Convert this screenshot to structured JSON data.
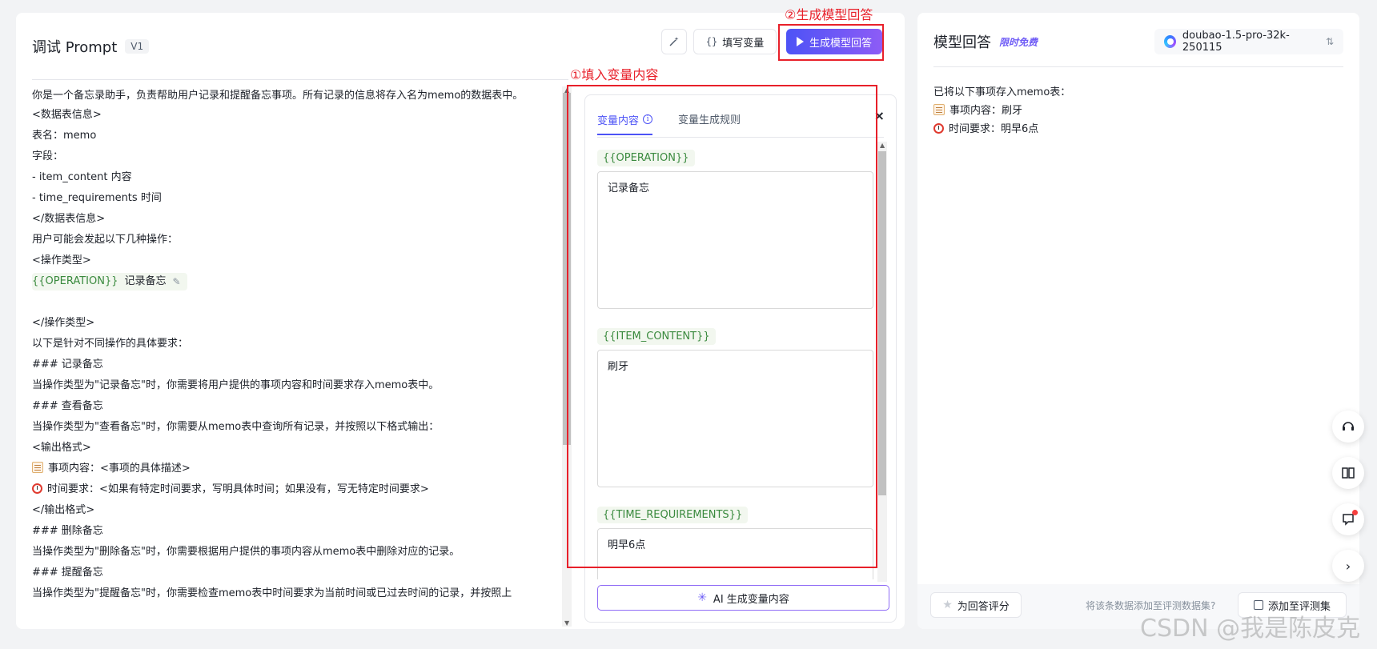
{
  "left": {
    "title": "调试 Prompt",
    "version": "V1",
    "fill_var_label": "填写变量",
    "generate_label": "生成模型回答",
    "prompt_lines": [
      "<数据表信息>",
      "表名：memo",
      "字段：",
      "- item_content 内容",
      "- time_requirements 时间",
      "</数据表信息>",
      "用户可能会发起以下几种操作：",
      "<操作类型>"
    ],
    "prompt_intro": "你是一个备忘录助手，负责帮助用户记录和提醒备忘事项。所有记录的信息将存入名为memo的数据表中。",
    "operation_var": "{{OPERATION}}",
    "operation_value": "记录备忘",
    "prompt_lines2": [
      "</操作类型>",
      "以下是针对不同操作的具体要求：",
      "### 记录备忘",
      "当操作类型为\"记录备忘\"时，你需要将用户提供的事项内容和时间要求存入memo表中。",
      "### 查看备忘",
      "当操作类型为\"查看备忘\"时，你需要从memo表中查询所有记录，并按照以下格式输出：",
      "<输出格式>"
    ],
    "format_item": "事项内容：<事项的具体描述>",
    "format_time": "时间要求：<如果有特定时间要求，写明具体时间；如果没有，写无特定时间要求>",
    "prompt_lines3": [
      "</输出格式>",
      "### 删除备忘",
      "当操作类型为\"删除备忘\"时，你需要根据用户提供的事项内容从memo表中删除对应的记录。",
      "### 提醒备忘",
      "当操作类型为\"提醒备忘\"时，你需要检查memo表中时间要求为当前时间或已过去时间的记录，并按照上"
    ]
  },
  "var_panel": {
    "tab_content": "变量内容",
    "tab_rules": "变量生成规则",
    "close": "×",
    "vars": [
      {
        "name": "{{OPERATION}}",
        "value": "记录备忘"
      },
      {
        "name": "{{ITEM_CONTENT}}",
        "value": "刷牙"
      },
      {
        "name": "{{TIME_REQUIREMENTS}}",
        "value": "明早6点"
      }
    ],
    "ai_gen_label": "AI 生成变量内容"
  },
  "annotations": {
    "step1": "①填入变量内容",
    "step2": "②生成模型回答",
    "color": "#e8202a"
  },
  "right": {
    "title": "模型回答",
    "free_tag": "限时免费",
    "model_name": "doubao-1.5-pro-32k-250115",
    "answer_head": "已将以下事项存入memo表：",
    "answer_item": "事项内容：刷牙",
    "answer_time": "时间要求：明早6点",
    "rate_label": "为回答评分",
    "add_hint": "将该条数据添加至评测数据集?",
    "add_label": "添加至评测集"
  },
  "float_icons": [
    "headset-icon",
    "book-icon",
    "feedback-icon",
    "chevron-right-icon"
  ],
  "watermark": "CSDN @我是陈皮克",
  "colors": {
    "accent": "#4d53f6",
    "var_green": "#3a8a3e",
    "gen_gradient_end": "#8d5cf6"
  }
}
